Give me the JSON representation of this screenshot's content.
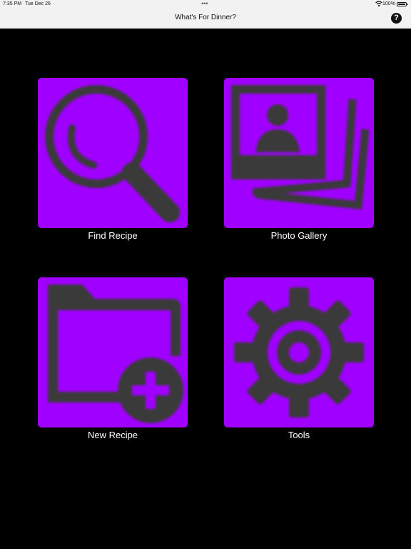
{
  "status_bar": {
    "time": "7:35 PM",
    "date": "Tue Dec 26",
    "dots": "•••",
    "battery": "100%"
  },
  "nav": {
    "title": "What's For Dinner?",
    "help_label": "?"
  },
  "tiles": [
    {
      "label": "Find Recipe",
      "icon": "magnifying-glass-icon"
    },
    {
      "label": "Photo Gallery",
      "icon": "photo-gallery-icon"
    },
    {
      "label": "New Recipe",
      "icon": "folder-add-icon"
    },
    {
      "label": "Tools",
      "icon": "gear-icon"
    }
  ],
  "colors": {
    "tile_bg": "#a000ff",
    "icon_ink": "#3a3a3a",
    "background": "#000000"
  }
}
